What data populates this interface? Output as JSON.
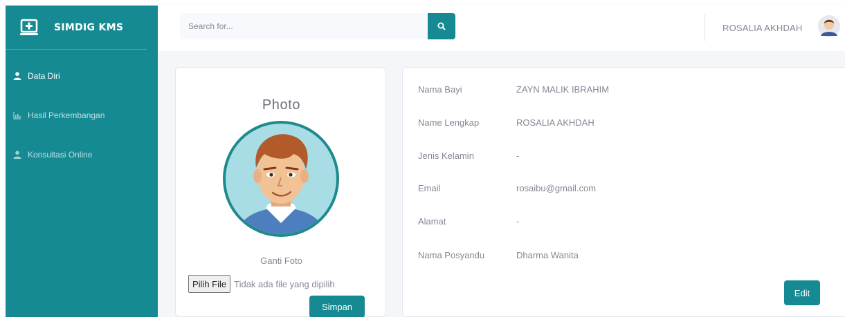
{
  "brand": {
    "name": "SIMDIG KMS",
    "icon": "laptop-plus-icon"
  },
  "sidebar": {
    "items": [
      {
        "label": "Data Diri",
        "icon": "user-icon",
        "active": true
      },
      {
        "label": "Hasil Perkembangan",
        "icon": "chart-icon",
        "active": false
      },
      {
        "label": "Konsultasi Online",
        "icon": "user-icon",
        "active": false
      }
    ]
  },
  "topbar": {
    "search": {
      "placeholder": "Search for...",
      "icon": "search-icon"
    },
    "user_name": "ROSALIA AKHDAH"
  },
  "photo_card": {
    "title": "Photo",
    "change_label": "Ganti Foto",
    "file_button": "Pilih File",
    "file_status": "Tidak ada file yang dipilih",
    "save_button": "Simpan"
  },
  "profile": {
    "fields": [
      {
        "label": "Nama Bayi",
        "value": "ZAYN MALIK IBRAHIM"
      },
      {
        "label": "Name Lengkap",
        "value": "ROSALIA AKHDAH"
      },
      {
        "label": "Jenis Kelamin",
        "value": "-"
      },
      {
        "label": "Email",
        "value": "rosaibu@gmail.com"
      },
      {
        "label": "Alamat",
        "value": "-"
      },
      {
        "label": "Nama Posyandu",
        "value": "Dharma Wanita"
      }
    ],
    "edit_button": "Edit"
  },
  "colors": {
    "accent": "#168a93",
    "text": "#858796",
    "background": "#f5f6fa"
  }
}
